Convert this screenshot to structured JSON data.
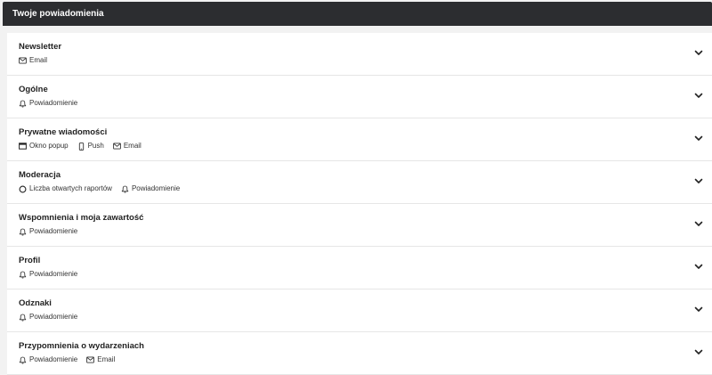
{
  "header": {
    "title": "Twoje powiadomienia"
  },
  "sections": [
    {
      "title": "Newsletter",
      "channels": [
        {
          "icon": "mail-icon",
          "label": "Email"
        }
      ]
    },
    {
      "title": "Ogólne",
      "channels": [
        {
          "icon": "bell-icon",
          "label": "Powiadomienie"
        }
      ]
    },
    {
      "title": "Prywatne wiadomości",
      "channels": [
        {
          "icon": "window-icon",
          "label": "Okno popup"
        },
        {
          "icon": "phone-icon",
          "label": "Push"
        },
        {
          "icon": "mail-icon",
          "label": "Email"
        }
      ]
    },
    {
      "title": "Moderacja",
      "channels": [
        {
          "icon": "circle-icon",
          "label": "Liczba otwartych raportów"
        },
        {
          "icon": "bell-icon",
          "label": "Powiadomienie"
        }
      ]
    },
    {
      "title": "Wspomnienia i moja zawartość",
      "channels": [
        {
          "icon": "bell-icon",
          "label": "Powiadomienie"
        }
      ]
    },
    {
      "title": "Profil",
      "channels": [
        {
          "icon": "bell-icon",
          "label": "Powiadomienie"
        }
      ]
    },
    {
      "title": "Odznaki",
      "channels": [
        {
          "icon": "bell-icon",
          "label": "Powiadomienie"
        }
      ]
    },
    {
      "title": "Przypomnienia o wydarzeniach",
      "channels": [
        {
          "icon": "bell-icon",
          "label": "Powiadomienie"
        },
        {
          "icon": "mail-icon",
          "label": "Email"
        }
      ]
    }
  ],
  "expand_icon": "chevron-down-icon"
}
